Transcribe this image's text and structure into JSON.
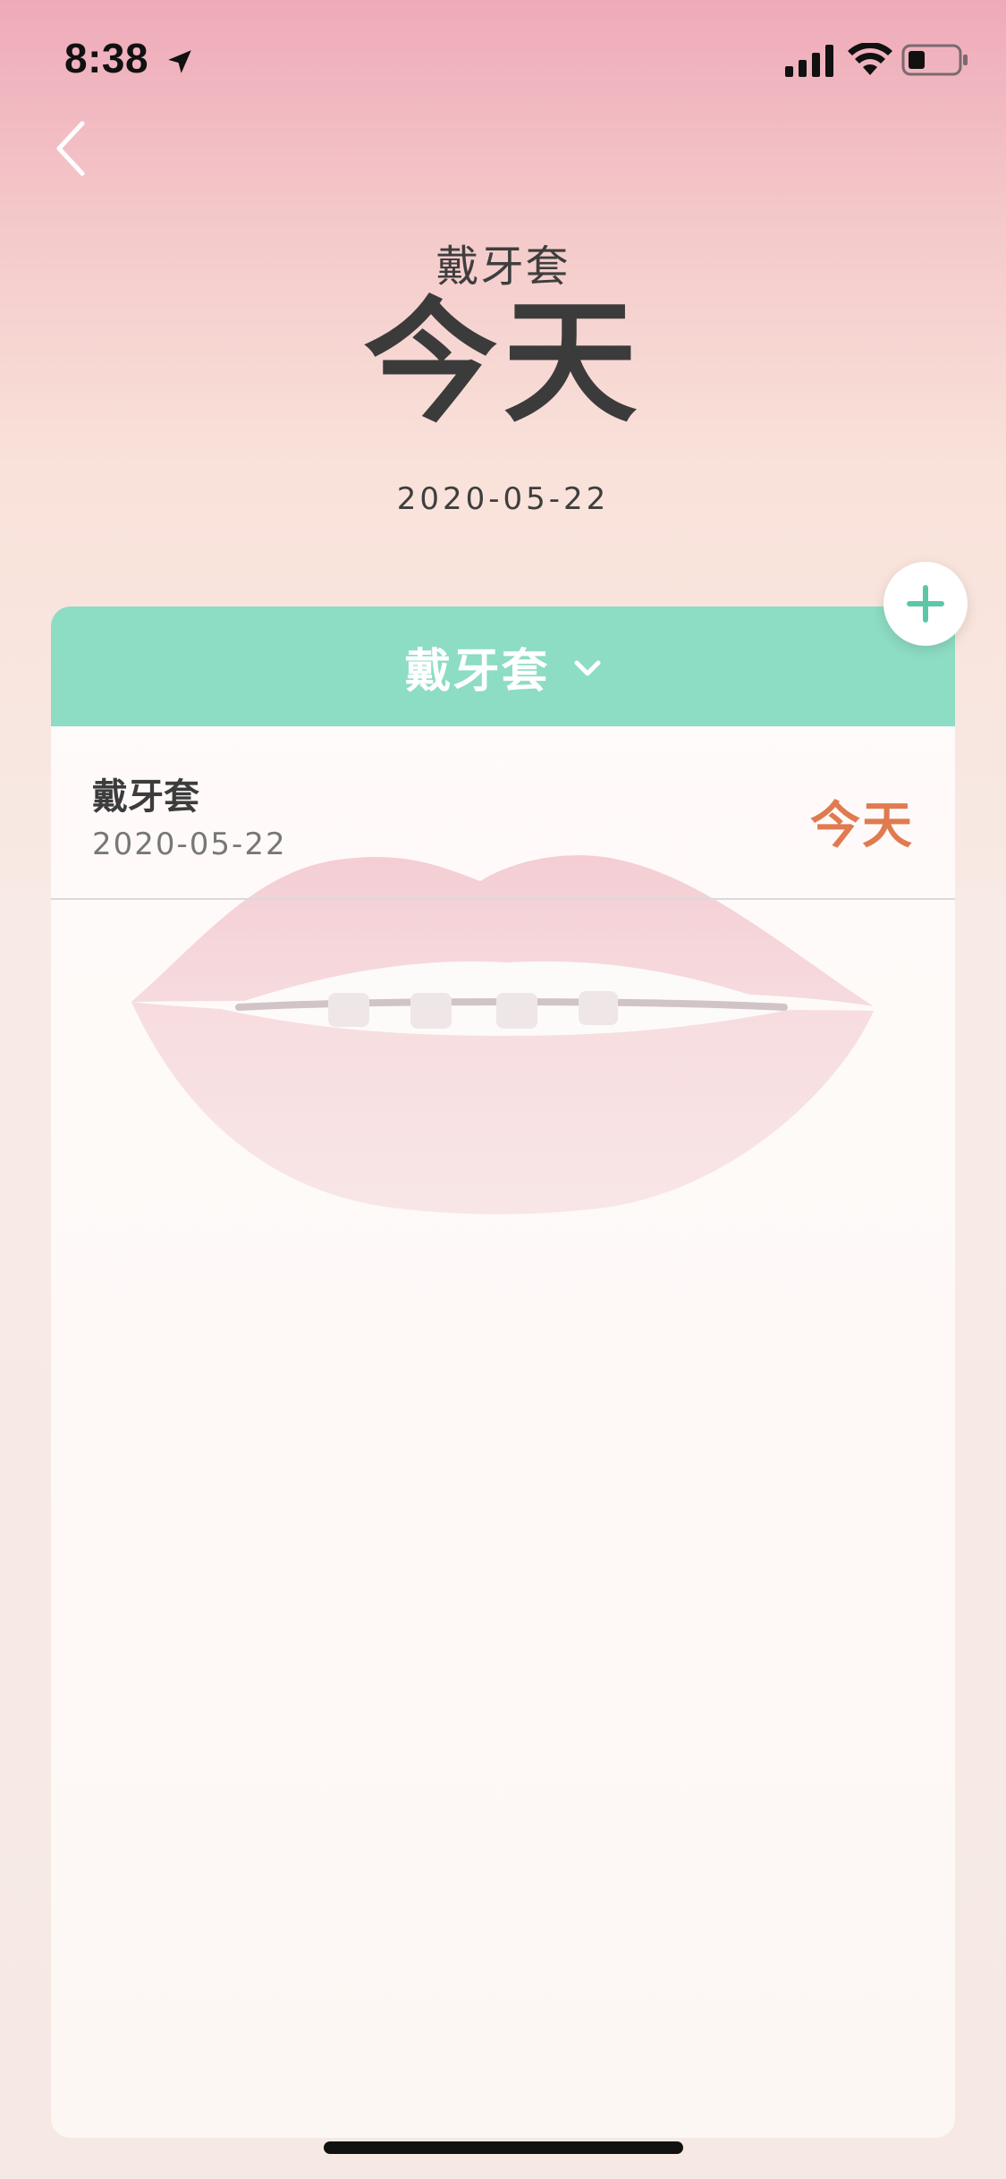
{
  "status_bar": {
    "time": "8:38",
    "icons": [
      "location-arrow-icon",
      "cellular-signal-icon",
      "wifi-icon",
      "battery-icon"
    ]
  },
  "nav": {
    "back_icon": "chevron-left-icon"
  },
  "header": {
    "subtitle": "戴牙套",
    "title": "今天",
    "date": "2020-05-22"
  },
  "card": {
    "header_color": "#8ddcc4",
    "category_label": "戴牙套",
    "category_icon": "chevron-down-icon",
    "items": [
      {
        "title": "戴牙套",
        "date": "2020-05-22",
        "status": "今天"
      }
    ]
  },
  "add_button": {
    "icon": "plus-icon",
    "color": "#5cc7a6"
  },
  "colors": {
    "accent_green": "#8ddcc4",
    "status_orange": "#e07a50",
    "background_top": "#eeaab9"
  }
}
